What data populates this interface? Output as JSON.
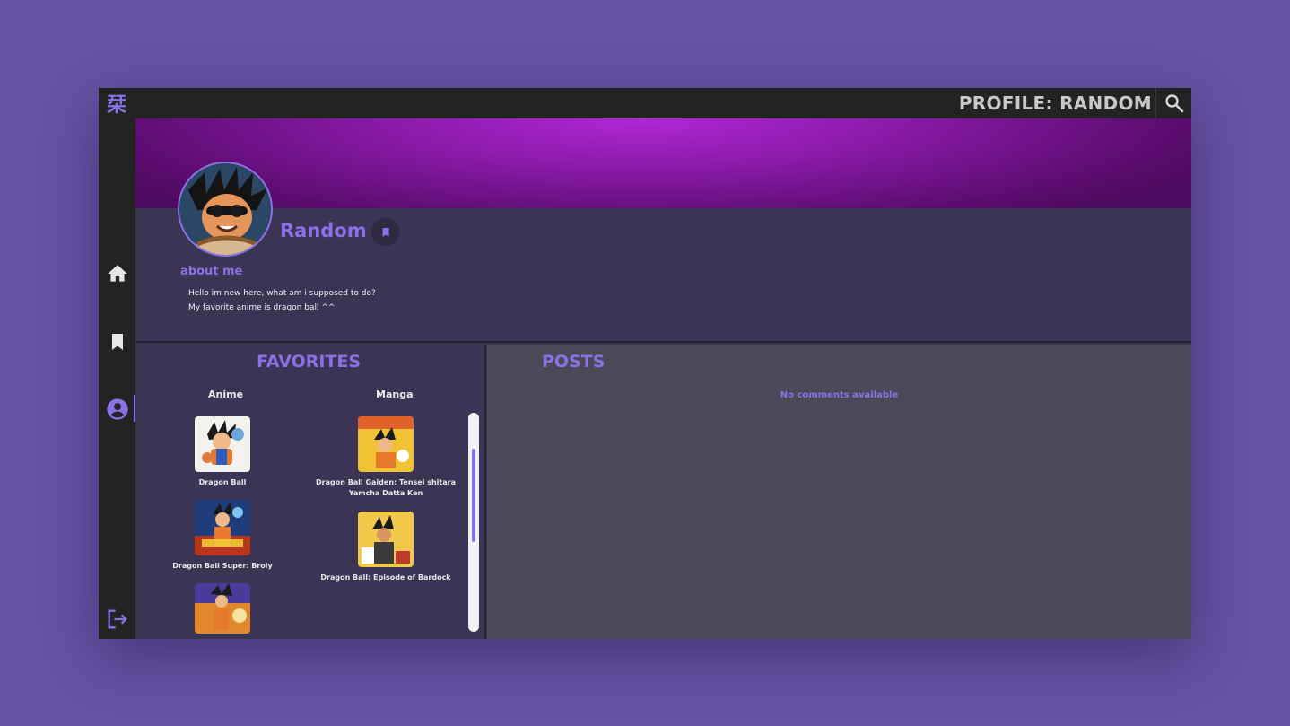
{
  "app": {
    "logo_glyph": "栞",
    "page_title": "PROFILE: RANDOM",
    "accent_color": "#8a72e6"
  },
  "sidebar": {
    "items": [
      {
        "name": "home",
        "icon": "home-icon"
      },
      {
        "name": "bookmarks",
        "icon": "bookmark-icon"
      },
      {
        "name": "profile",
        "icon": "account-circle-icon",
        "active": true
      },
      {
        "name": "logout",
        "icon": "logout-icon"
      }
    ]
  },
  "profile": {
    "username": "Random",
    "about_title": "about me",
    "about_lines": [
      "Hello im new here, what am i supposed to do?",
      "My favorite anime is dragon ball ^^"
    ]
  },
  "favorites": {
    "title": "FAVORITES",
    "anime_header": "Anime",
    "manga_header": "Manga",
    "anime": [
      {
        "title": "Dragon Ball"
      },
      {
        "title": "Dragon Ball Super: Broly"
      },
      {
        "title": ""
      }
    ],
    "manga": [
      {
        "title": "Dragon Ball Gaiden: Tensei shitara Yamcha Datta Ken"
      },
      {
        "title": "Dragon Ball: Episode of Bardock"
      }
    ]
  },
  "posts": {
    "title": "POSTS",
    "empty_message": "No comments available"
  }
}
